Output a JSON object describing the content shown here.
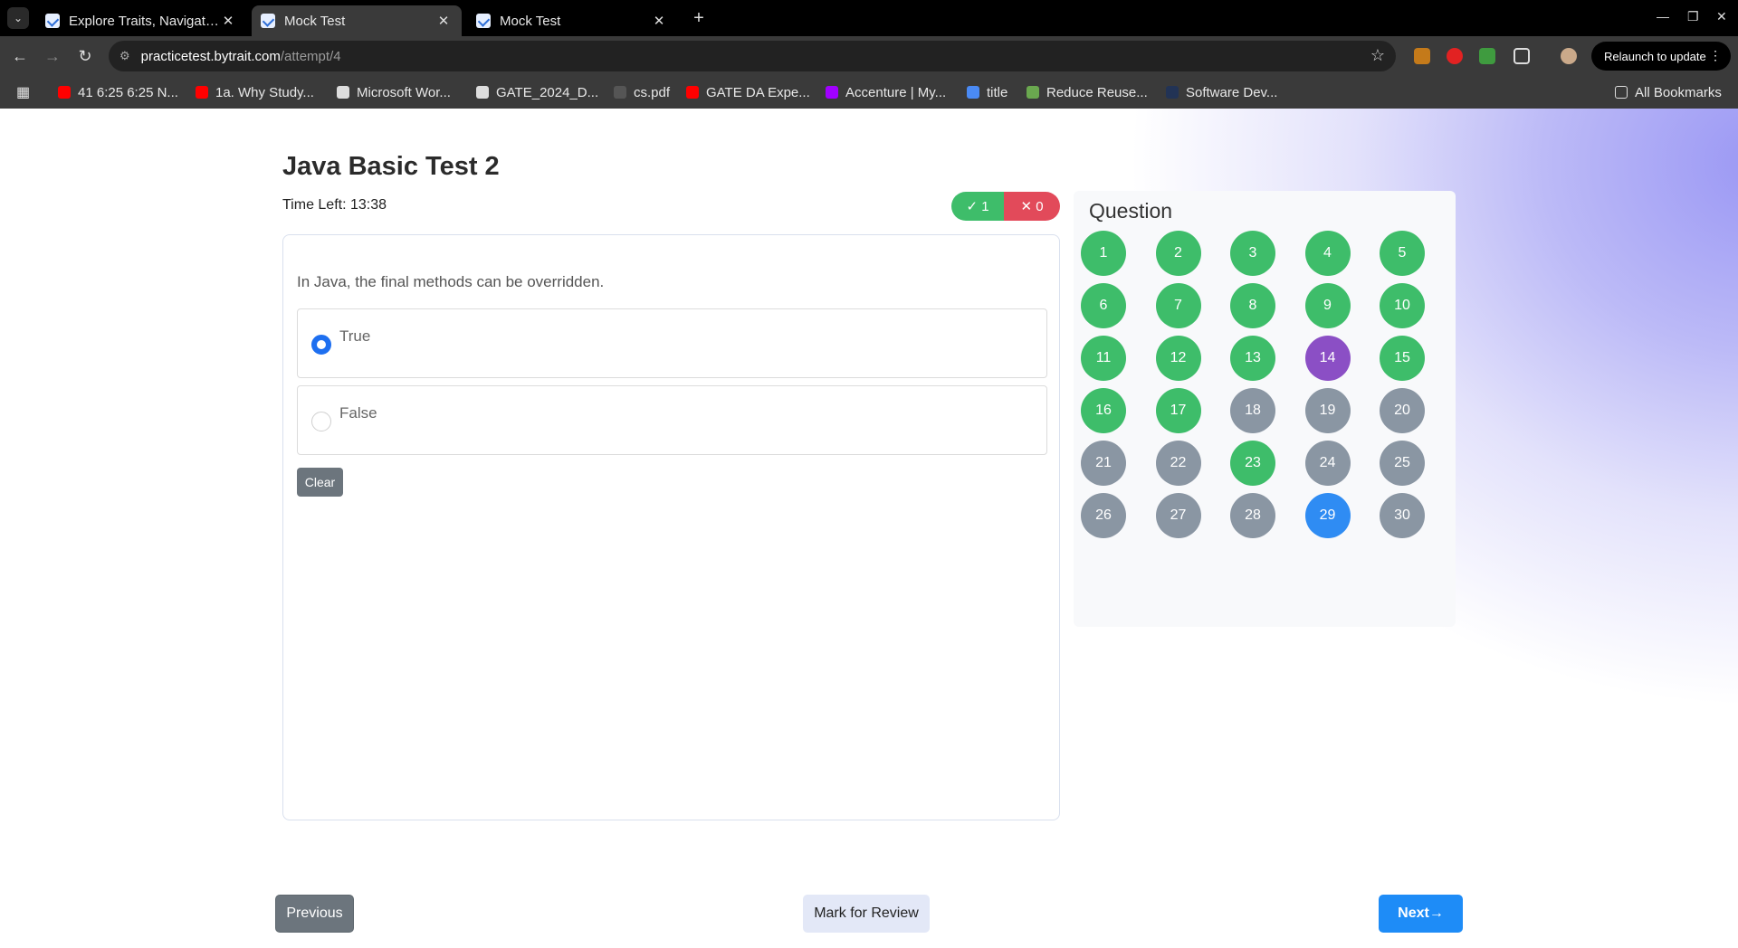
{
  "browser": {
    "tabs": [
      {
        "title": "Explore Traits, Navigate C",
        "active": false
      },
      {
        "title": "Mock Test",
        "active": true
      },
      {
        "title": "Mock Test",
        "active": false
      }
    ],
    "url_host": "practicetest.bytrait.com",
    "url_path": "/attempt/4",
    "relaunch_label": "Relaunch to update",
    "bookmarks": [
      {
        "label": "41 6:25 6:25 N...",
        "color": "#ff0000"
      },
      {
        "label": "1a. Why Study...",
        "color": "#ff0000"
      },
      {
        "label": "Microsoft Wor...",
        "color": "#dddddd"
      },
      {
        "label": "GATE_2024_D...",
        "color": "#dddddd"
      },
      {
        "label": "cs.pdf",
        "color": "#555555"
      },
      {
        "label": "GATE DA Expe...",
        "color": "#ff0000"
      },
      {
        "label": "Accenture | My...",
        "color": "#a100ff"
      },
      {
        "label": "title",
        "color": "#4a8af4"
      },
      {
        "label": "Reduce Reuse...",
        "color": "#6aa84f"
      },
      {
        "label": "Software Dev...",
        "color": "#223355"
      }
    ],
    "all_bookmarks": "All Bookmarks"
  },
  "test": {
    "title": "Java Basic Test 2",
    "time_left": "Time Left: 13:38",
    "score_correct": "1",
    "score_wrong": "0"
  },
  "question": {
    "text": "In Java, the final methods can be overridden.",
    "options": [
      {
        "label": "True",
        "selected": true
      },
      {
        "label": "False",
        "selected": false
      }
    ],
    "clear_label": "Clear"
  },
  "panel": {
    "title": "Question",
    "status_colors": {
      "answered": "#3ebd6a",
      "review": "#8b4fc5",
      "current": "#2f8cf3",
      "unvisited": "#8a96a3"
    },
    "questions": [
      {
        "n": "1",
        "status": "answered"
      },
      {
        "n": "2",
        "status": "answered"
      },
      {
        "n": "3",
        "status": "answered"
      },
      {
        "n": "4",
        "status": "answered"
      },
      {
        "n": "5",
        "status": "answered"
      },
      {
        "n": "6",
        "status": "answered"
      },
      {
        "n": "7",
        "status": "answered"
      },
      {
        "n": "8",
        "status": "answered"
      },
      {
        "n": "9",
        "status": "answered"
      },
      {
        "n": "10",
        "status": "answered"
      },
      {
        "n": "11",
        "status": "answered"
      },
      {
        "n": "12",
        "status": "answered"
      },
      {
        "n": "13",
        "status": "answered"
      },
      {
        "n": "14",
        "status": "review"
      },
      {
        "n": "15",
        "status": "answered"
      },
      {
        "n": "16",
        "status": "answered"
      },
      {
        "n": "17",
        "status": "answered"
      },
      {
        "n": "18",
        "status": "unvisited"
      },
      {
        "n": "19",
        "status": "unvisited"
      },
      {
        "n": "20",
        "status": "unvisited"
      },
      {
        "n": "21",
        "status": "unvisited"
      },
      {
        "n": "22",
        "status": "unvisited"
      },
      {
        "n": "23",
        "status": "answered"
      },
      {
        "n": "24",
        "status": "unvisited"
      },
      {
        "n": "25",
        "status": "unvisited"
      },
      {
        "n": "26",
        "status": "unvisited"
      },
      {
        "n": "27",
        "status": "unvisited"
      },
      {
        "n": "28",
        "status": "unvisited"
      },
      {
        "n": "29",
        "status": "current"
      },
      {
        "n": "30",
        "status": "unvisited"
      }
    ]
  },
  "footer": {
    "previous_label": "Previous",
    "mark_label": "Mark for Review",
    "next_label": "Next→"
  }
}
